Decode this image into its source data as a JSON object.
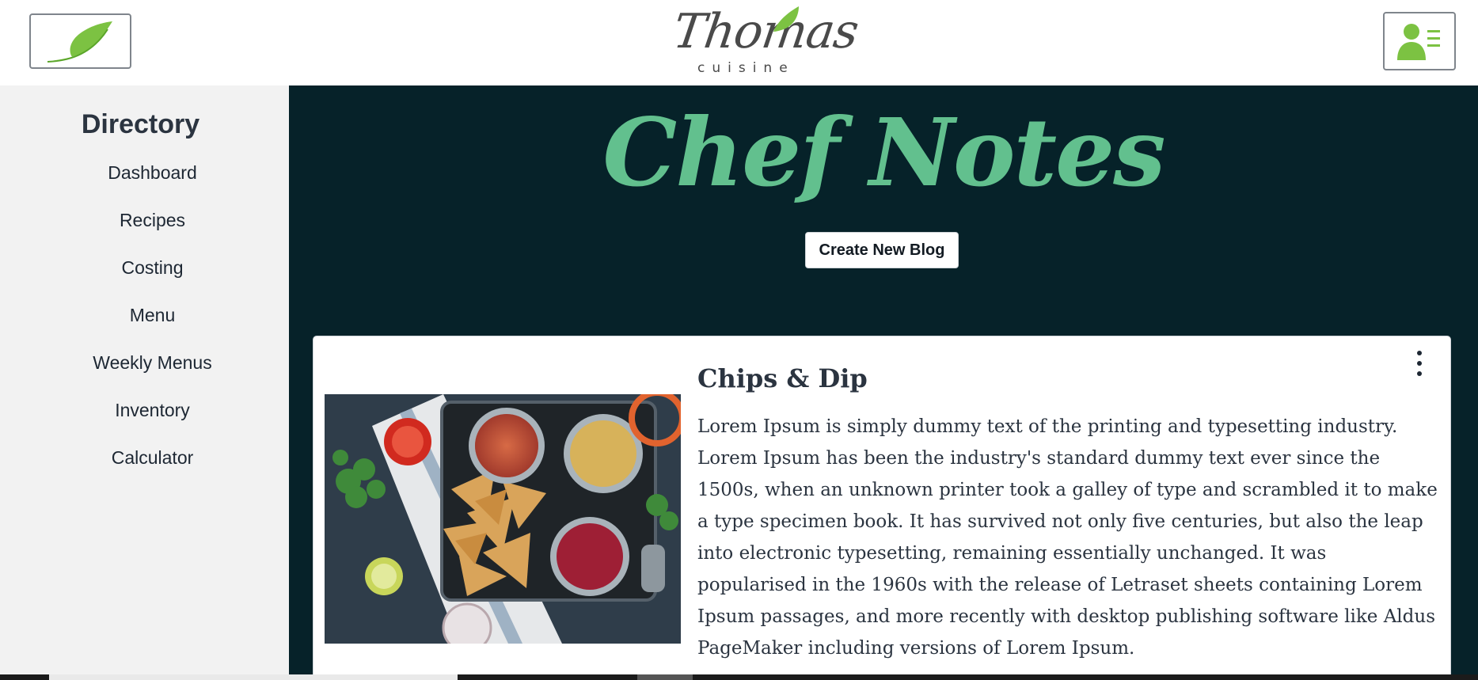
{
  "header": {
    "leaf_button_icon": "leaf-icon",
    "logo": {
      "script_text": "Thomas",
      "sub_text": "cuisine"
    },
    "profile_button_icon": "user-list-icon"
  },
  "sidebar": {
    "title": "Directory",
    "items": [
      {
        "label": "Dashboard"
      },
      {
        "label": "Recipes"
      },
      {
        "label": "Costing"
      },
      {
        "label": "Menu"
      },
      {
        "label": "Weekly Menus"
      },
      {
        "label": "Inventory"
      },
      {
        "label": "Calculator"
      }
    ]
  },
  "main": {
    "title": "Chef Notes",
    "create_button": "Create New Blog",
    "card": {
      "title": "Chips & Dip",
      "body": "Lorem Ipsum is simply dummy text of the printing and typesetting industry. Lorem Ipsum has been the industry's standard dummy text ever since the 1500s, when an unknown printer took a galley of type and scrambled it to make a type specimen book. It has survived not only five centuries, but also the leap into electronic typesetting, remaining essentially unchanged. It was popularised in the 1960s with the release of Letraset sheets containing Lorem Ipsum passages, and more recently with desktop publishing software like Aldus PageMaker including versions of Lorem Ipsum.",
      "image_icon": "chips-and-dip-photo",
      "menu_icon": "more-vertical-icon"
    }
  },
  "colors": {
    "main_bg": "#062229",
    "title_green": "#62c08e",
    "leaf_green": "#7cc242",
    "sidebar_bg": "#f2f2f2",
    "text_dark": "#2b3440"
  }
}
